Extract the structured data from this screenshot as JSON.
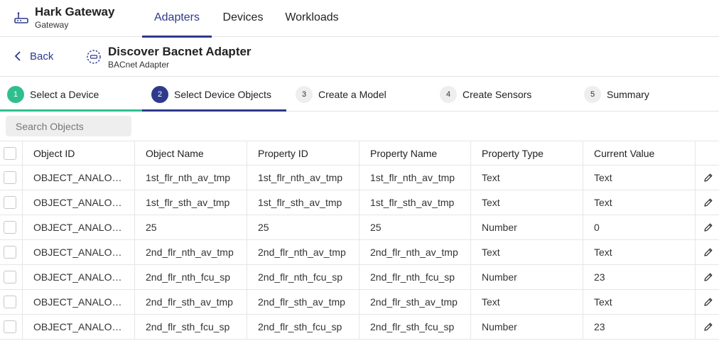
{
  "app": {
    "title": "Hark Gateway",
    "subtitle": "Gateway"
  },
  "nav": {
    "tabs": [
      {
        "label": "Adapters",
        "active": true
      },
      {
        "label": "Devices",
        "active": false
      },
      {
        "label": "Workloads",
        "active": false
      }
    ]
  },
  "subheader": {
    "back_label": "Back",
    "title": "Discover Bacnet Adapter",
    "subtitle": "BACnet Adapter"
  },
  "steps": [
    {
      "number": "1",
      "label": "Select a Device",
      "state": "done"
    },
    {
      "number": "2",
      "label": "Select Device Objects",
      "state": "current"
    },
    {
      "number": "3",
      "label": "Create a Model",
      "state": "upcoming"
    },
    {
      "number": "4",
      "label": "Create Sensors",
      "state": "upcoming"
    },
    {
      "number": "5",
      "label": "Summary",
      "state": "upcoming"
    }
  ],
  "search": {
    "placeholder": "Search Objects"
  },
  "table": {
    "columns": [
      "Object ID",
      "Object Name",
      "Property ID",
      "Property Name",
      "Property Type",
      "Current Value"
    ],
    "rows": [
      [
        "OBJECT_ANALOG...",
        "1st_flr_nth_av_tmp",
        "1st_flr_nth_av_tmp",
        "1st_flr_nth_av_tmp",
        "Text",
        "Text"
      ],
      [
        "OBJECT_ANALOG...",
        "1st_flr_sth_av_tmp",
        "1st_flr_sth_av_tmp",
        "1st_flr_sth_av_tmp",
        "Text",
        "Text"
      ],
      [
        "OBJECT_ANALOG...",
        "25",
        "25",
        "25",
        "Number",
        "0"
      ],
      [
        "OBJECT_ANALOG...",
        "2nd_flr_nth_av_tmp",
        "2nd_flr_nth_av_tmp",
        "2nd_flr_nth_av_tmp",
        "Text",
        "Text"
      ],
      [
        "OBJECT_ANALOG...",
        "2nd_flr_nth_fcu_sp",
        "2nd_flr_nth_fcu_sp",
        "2nd_flr_nth_fcu_sp",
        "Number",
        "23"
      ],
      [
        "OBJECT_ANALOG...",
        "2nd_flr_sth_av_tmp",
        "2nd_flr_sth_av_tmp",
        "2nd_flr_sth_av_tmp",
        "Text",
        "Text"
      ],
      [
        "OBJECT_ANALOG...",
        "2nd_flr_sth_fcu_sp",
        "2nd_flr_sth_fcu_sp",
        "2nd_flr_sth_fcu_sp",
        "Number",
        "23"
      ]
    ]
  },
  "colors": {
    "accent": "#2e3a8c",
    "success": "#2fbf8f",
    "border": "#e6e6e6"
  },
  "icons": {
    "logo": "gateway-icon",
    "back": "chevron-left-icon",
    "adapter": "adapter-icon",
    "edit": "pencil-icon"
  }
}
